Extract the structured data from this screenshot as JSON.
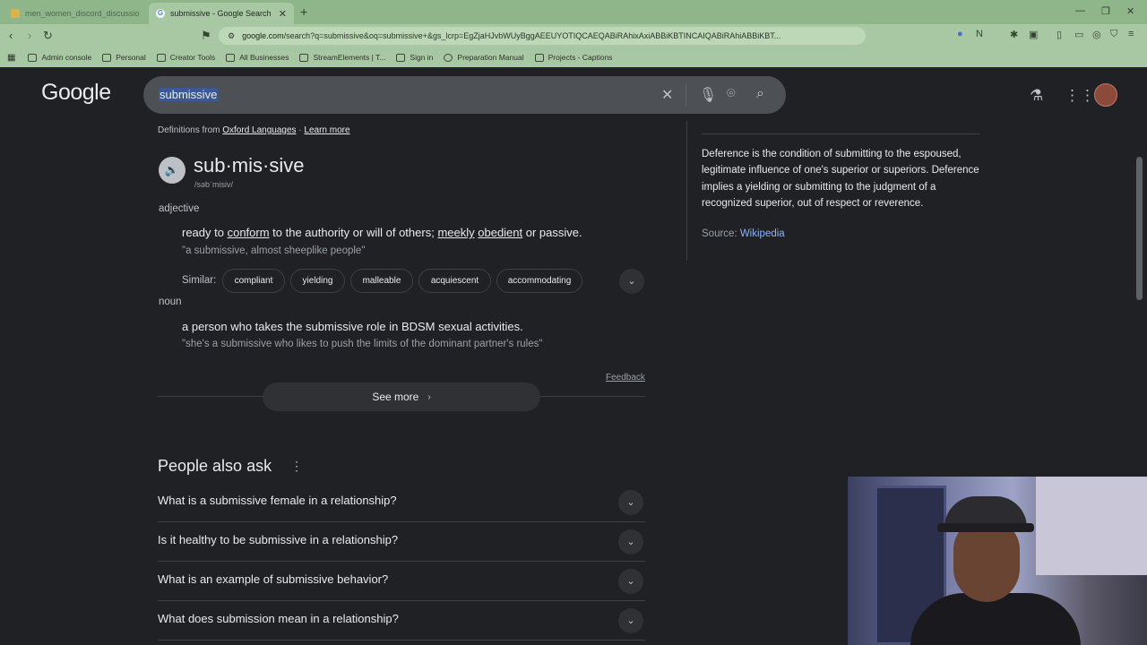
{
  "browser": {
    "tabs": [
      {
        "title": "men_women_discord_discussion_top",
        "active": false
      },
      {
        "title": "submissive - Google Search",
        "active": true
      }
    ],
    "url_domain": "google.com",
    "url_path": "/search?q=submissive&oq=submissive+&gs_lcrp=EgZjaHJvbWUyBggAEEUYOTIQCAEQABiRAhixAxiABBiKBTINCAIQABiRAhiABBiKBT...",
    "bookmarks": [
      "Admin console",
      "Personal",
      "Creator Tools",
      "All Businesses",
      "StreamElements | T...",
      "Sign in",
      "Preparation Manual",
      "Projects - Captions"
    ]
  },
  "google": {
    "logo": "Google",
    "query": "submissive"
  },
  "dictionary": {
    "source_prefix": "Definitions from",
    "source_name": "Oxford Languages",
    "learn_more": "Learn more",
    "word": "sub·mis·sive",
    "phonetic": "/səbˈmisiv/",
    "adjective_label": "adjective",
    "adj_def_parts": [
      "ready to ",
      "conform",
      " to the authority or will of others; ",
      "meekly",
      " ",
      "obedient",
      " or passive."
    ],
    "adj_example": "\"a submissive, almost sheeplike people\"",
    "similar_label": "Similar:",
    "similar": [
      "compliant",
      "yielding",
      "malleable",
      "acquiescent",
      "accommodating"
    ],
    "noun_label": "noun",
    "noun_def": "a person who takes the submissive role in BDSM sexual activities.",
    "noun_example": "\"she's a submissive who likes to push the limits of the dominant partner's rules\"",
    "feedback": "Feedback",
    "see_more": "See more"
  },
  "people_also_ask": {
    "title": "People also ask",
    "questions": [
      "What is a submissive female in a relationship?",
      "Is it healthy to be submissive in a relationship?",
      "What is an example of submissive behavior?",
      "What does submission mean in a relationship?"
    ]
  },
  "side_panel": {
    "text": "Deference is the condition of submitting to the espoused, legitimate influence of one's superior or superiors. Deference implies a yielding or submitting to the judgment of a recognized superior, out of respect or reverence.",
    "source_label": "Source: ",
    "source_name": "Wikipedia"
  }
}
